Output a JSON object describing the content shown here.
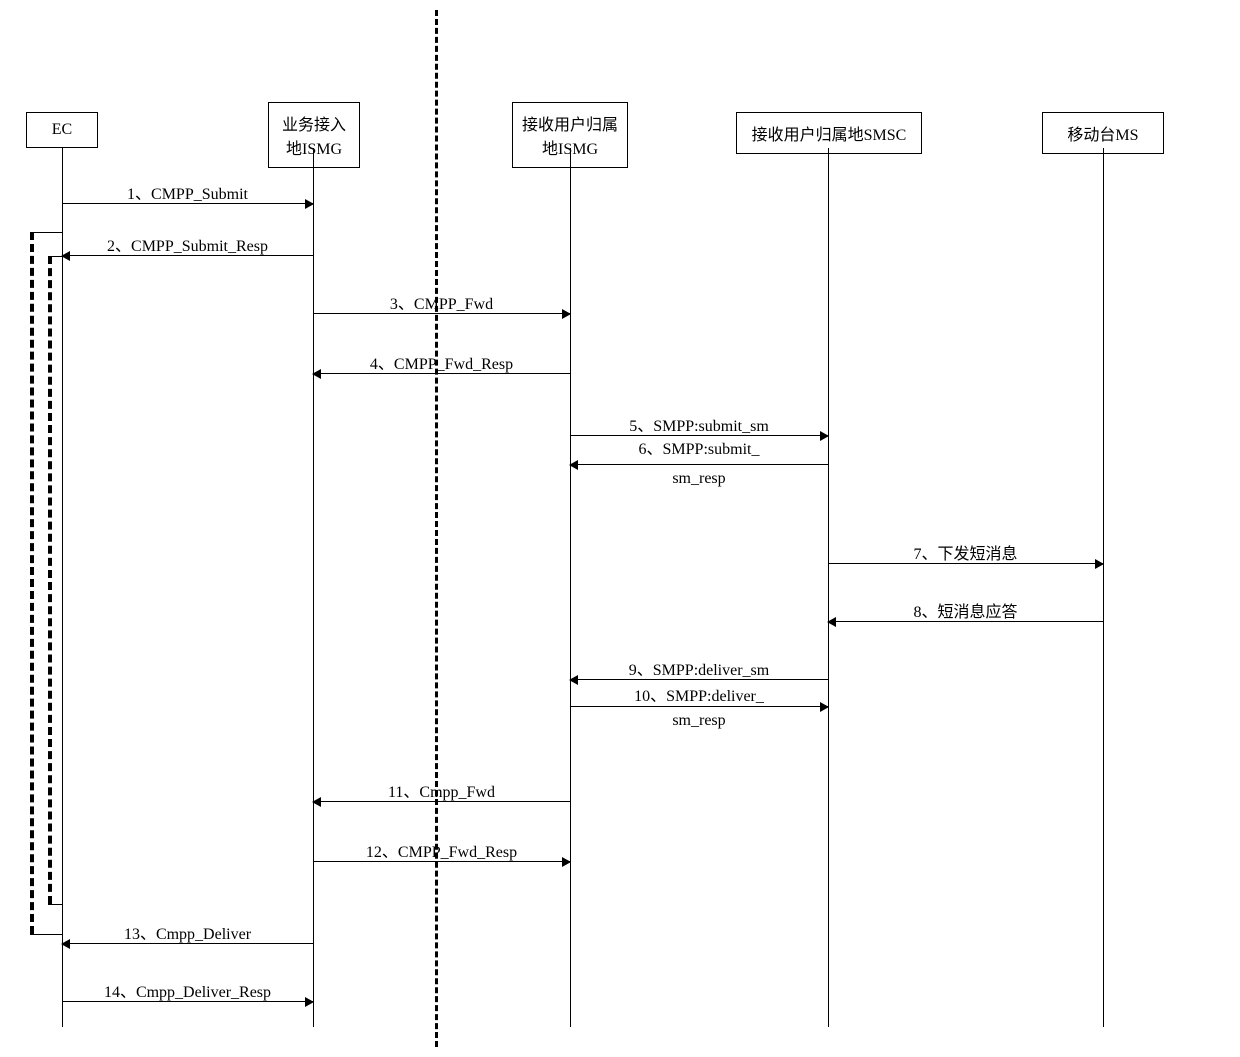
{
  "actors": {
    "ec": "EC",
    "localIsmg_l1": "业务接入",
    "localIsmg_l2": "地ISMG",
    "homeIsmg_l1": "接收用户归属",
    "homeIsmg_l2": "地ISMG",
    "smsc": "接收用户归属地SMSC",
    "ms": "移动台MS"
  },
  "messages": {
    "m1": "1、CMPP_Submit",
    "m2": "2、CMPP_Submit_Resp",
    "m3": "3、CMPP_Fwd",
    "m4": "4、CMPP_Fwd_Resp",
    "m5": "5、SMPP:submit_sm",
    "m6a": "6、SMPP:submit_",
    "m6b": "sm_resp",
    "m7": "7、下发短消息",
    "m8": "8、短消息应答",
    "m9": "9、SMPP:deliver_sm",
    "m10a": "10、SMPP:deliver_",
    "m10b": "sm_resp",
    "m11": "11、Cmpp_Fwd",
    "m12": "12、CMPP_Fwd_Resp",
    "m13": "13、Cmpp_Deliver",
    "m14": "14、Cmpp_Deliver_Resp"
  }
}
